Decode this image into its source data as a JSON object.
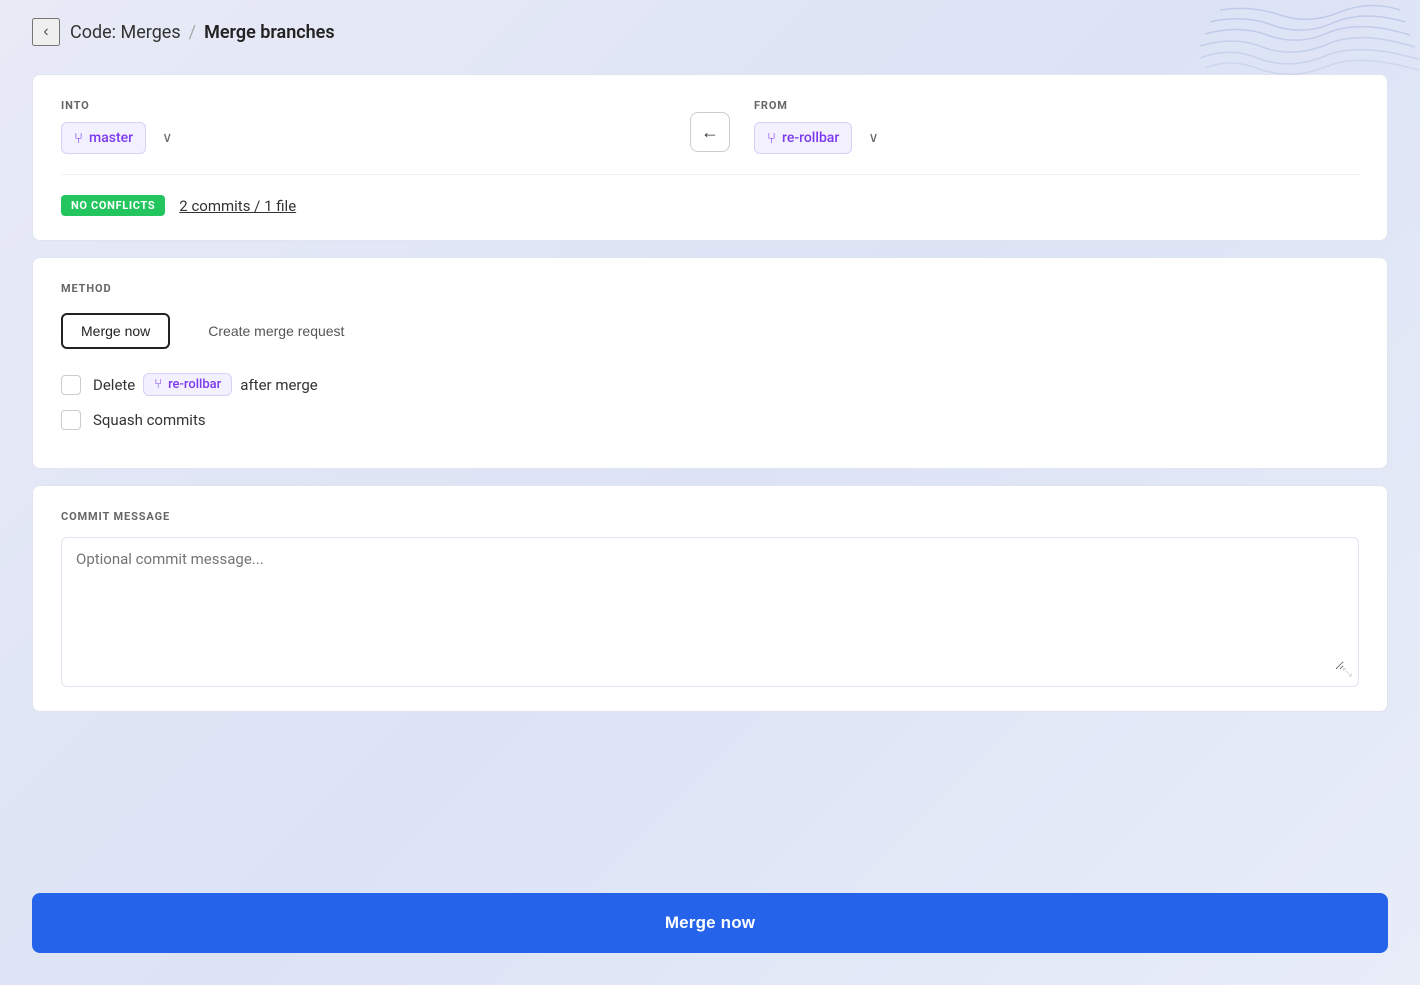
{
  "header": {
    "back_label": "‹",
    "breadcrumb_parent": "Code: Merges",
    "breadcrumb_separator": "/",
    "breadcrumb_current": "Merge branches"
  },
  "branch_section": {
    "into_label": "INTO",
    "from_label": "FROM",
    "into_branch": "master",
    "from_branch": "re-rollbar",
    "branch_icon": "⑂",
    "swap_icon": "←",
    "no_conflicts_badge": "NO CONFLICTS",
    "commits_info": "2 commits / 1 file"
  },
  "method_section": {
    "label": "METHOD",
    "merge_now_label": "Merge now",
    "create_merge_request_label": "Create merge request",
    "delete_checkbox_label_before": "Delete",
    "delete_branch": "re-rollbar",
    "delete_checkbox_label_after": "after merge",
    "squash_commits_label": "Squash commits"
  },
  "commit_message_section": {
    "label": "COMMIT MESSAGE",
    "placeholder": "Optional commit message..."
  },
  "footer": {
    "merge_now_label": "Merge now"
  }
}
